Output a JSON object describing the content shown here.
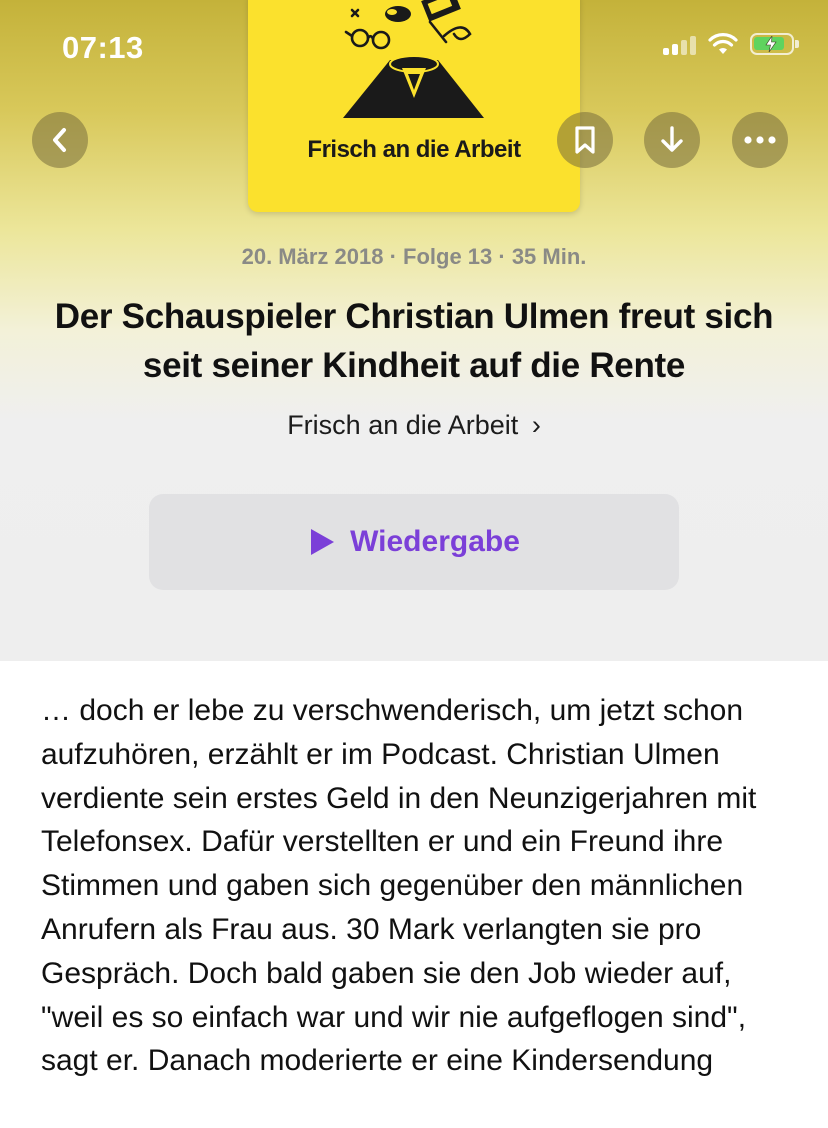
{
  "status_bar": {
    "time": "07:13"
  },
  "nav": {
    "back_icon": "chevron-left-icon",
    "bookmark_icon": "bookmark-icon",
    "download_icon": "download-arrow-icon",
    "more_icon": "ellipsis-icon"
  },
  "cover": {
    "title": "Frisch an die Arbeit",
    "background": "#fbe12d"
  },
  "episode": {
    "meta": "20. März 2018 · Folge 13 · 35 Min.",
    "title": "Der Schauspieler Christian Ulmen freut sich seit seiner Kindheit auf die Rente",
    "show_name": "Frisch an die Arbeit",
    "show_link_chevron": "›"
  },
  "play_button": {
    "label": "Wiedergabe",
    "accent": "#7b3fd8"
  },
  "description": "… doch er lebe zu verschwenderisch, um jetzt schon aufzuhören, erzählt er im Podcast. Christian Ulmen verdiente sein erstes Geld in den Neunzigerjahren mit Telefonsex. Dafür verstellten er und ein Freund ihre Stimmen und gaben sich gegenüber den männlichen Anrufern als Frau aus. 30 Mark verlangten sie pro Gespräch. Doch bald gaben sie den Job wieder auf, \"weil es so einfach war und wir nie aufgeflogen sind\", sagt er. Danach moderierte er eine Kindersendung"
}
